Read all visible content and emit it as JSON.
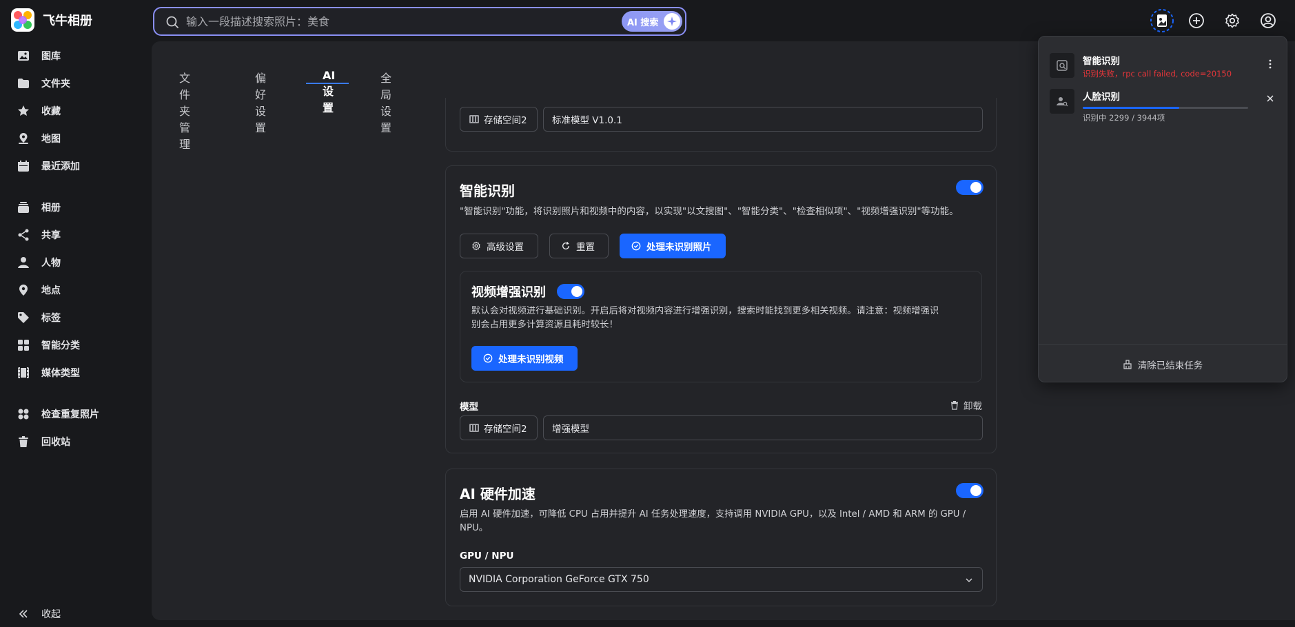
{
  "app": {
    "name": "飞牛相册"
  },
  "search": {
    "placeholder": "输入一段描述搜索照片：美食",
    "ai_label": "AI 搜索"
  },
  "sidebar": {
    "items": [
      {
        "label": "图库",
        "icon": "image-icon"
      },
      {
        "label": "文件夹",
        "icon": "folder-icon"
      },
      {
        "label": "收藏",
        "icon": "star-icon"
      },
      {
        "label": "地图",
        "icon": "map-pin-icon"
      },
      {
        "label": "最近添加",
        "icon": "calendar-icon"
      },
      {
        "label": "相册",
        "icon": "album-icon"
      },
      {
        "label": "共享",
        "icon": "share-icon"
      },
      {
        "label": "人物",
        "icon": "person-icon"
      },
      {
        "label": "地点",
        "icon": "location-icon"
      },
      {
        "label": "标签",
        "icon": "tag-icon"
      },
      {
        "label": "智能分类",
        "icon": "grid-icon"
      },
      {
        "label": "媒体类型",
        "icon": "film-icon"
      },
      {
        "label": "检查重复照片",
        "icon": "duplicate-icon"
      },
      {
        "label": "回收站",
        "icon": "trash-icon"
      }
    ],
    "collapse_label": "收起"
  },
  "tabs": [
    {
      "label": "文件夹管理"
    },
    {
      "label": "偏好设置"
    },
    {
      "label": "AI 设置",
      "active": true
    },
    {
      "label": "全局设置"
    }
  ],
  "model_card_top": {
    "storage_label": "存储空间2",
    "model_value": "标准模型 V1.0.1"
  },
  "smart_recognition": {
    "title": "智能识别",
    "enabled": true,
    "description": "\"智能识别\"功能，将识别照片和视频中的内容，以实现\"以文搜图\"、\"智能分类\"、\"检查相似项\"、\"视频增强识别\"等功能。",
    "advanced_label": "高级设置",
    "reset_label": "重置",
    "process_photos_label": "处理未识别照片",
    "video_enhance": {
      "title": "视频增强识别",
      "enabled": true,
      "description_line1": "默认会对视频进行基础识别。开启后将对视频内容进行增强识别，搜索时能找到更多相关视频。请注意：视频增强识",
      "description_line2": "别会占用更多计算资源且耗时较长！",
      "process_videos_label": "处理未识别视频"
    },
    "model_label": "模型",
    "uninstall_label": "卸载",
    "storage_label": "存储空间2",
    "model_value": "增强模型"
  },
  "hw_accel": {
    "title": "AI 硬件加速",
    "enabled": true,
    "description_line1": "启用 AI 硬件加速，可降低 CPU 占用并提升 AI 任务处理速度，支持调用 NVIDIA GPU，以及 Intel / AMD 和 ARM 的 GPU /",
    "description_line2": "NPU。",
    "gpu_label": "GPU / NPU",
    "gpu_value": "NVIDIA Corporation GeForce GTX 750"
  },
  "tasks": {
    "items": [
      {
        "name": "智能识别",
        "error": "识别失败，rpc call failed, code=20150"
      },
      {
        "name": "人脸识别",
        "status": "识别中 2299 / 3944项",
        "progress": 0.583
      }
    ],
    "clear_label": "清除已结束任务"
  },
  "colors": {
    "accent": "#1a66ff",
    "error": "#e5363a",
    "ai_gradient": "#8d97f4"
  }
}
